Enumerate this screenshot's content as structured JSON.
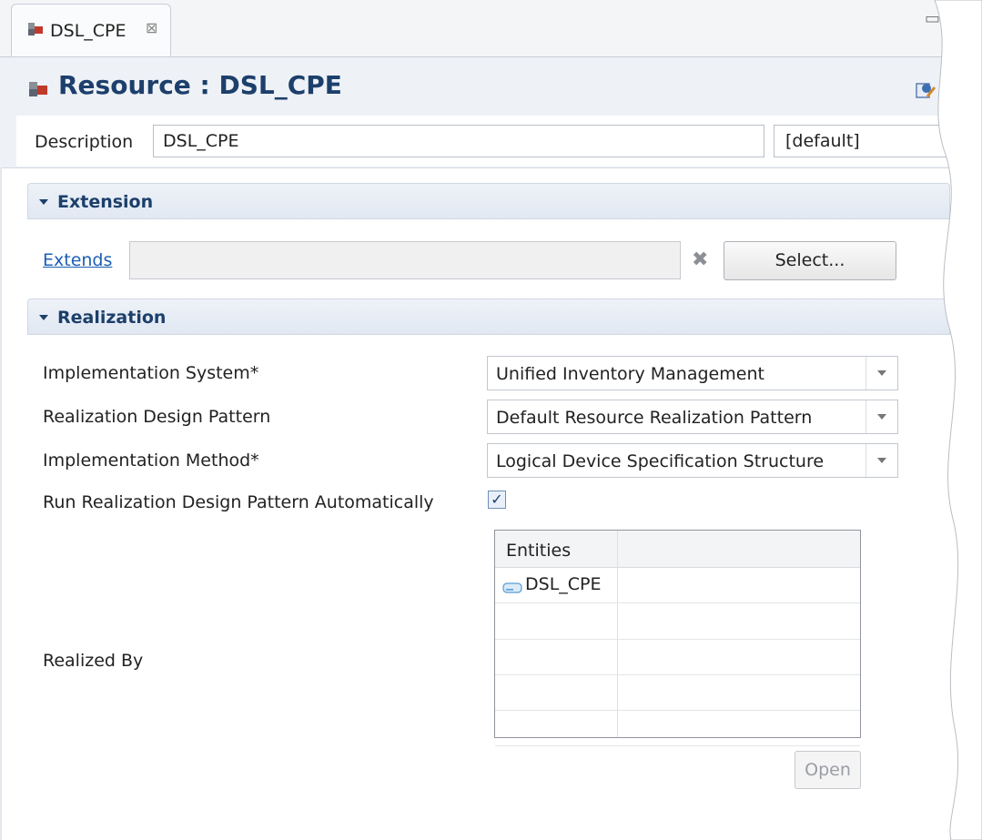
{
  "tab": {
    "label": "DSL_CPE",
    "close_glyph": "⊠"
  },
  "header": {
    "title": "Resource : DSL_CPE",
    "help_glyph": "?",
    "description": {
      "label": "Description",
      "value": "DSL_CPE",
      "language": "[default]"
    }
  },
  "extension": {
    "title": "Extension",
    "extends_link": "Extends",
    "extends_value": "",
    "clear_glyph": "✖",
    "select_label": "Select..."
  },
  "realization": {
    "title": "Realization",
    "fields": [
      {
        "label": "Implementation System*",
        "value": "Unified Inventory Management"
      },
      {
        "label": "Realization Design Pattern",
        "value": "Default Resource Realization Pattern"
      },
      {
        "label": "Implementation Method*",
        "value": "Logical Device Specification Structure"
      }
    ],
    "run_auto": {
      "label": "Run Realization Design Pattern Automatically",
      "checked": true,
      "check_glyph": "✓"
    },
    "realized_by": {
      "label": "Realized By",
      "columns": [
        "Entities",
        ""
      ],
      "rows": [
        "DSL_CPE"
      ],
      "open_label": "Open"
    }
  },
  "icons": {
    "tab": "resource-icon",
    "title": "resource-icon",
    "header_a": "form-edit-icon",
    "header_b": "help-icon",
    "entity": "entity-icon"
  },
  "colors": {
    "title": "#1c3f6b",
    "link": "#1a5fb4",
    "section_bg": "#e1e8f2"
  }
}
